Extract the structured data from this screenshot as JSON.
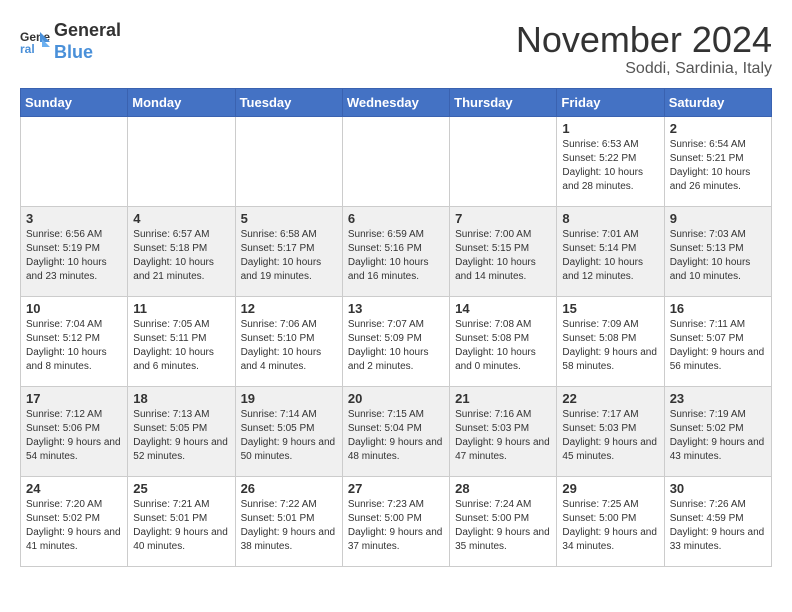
{
  "logo": {
    "line1": "General",
    "line2": "Blue"
  },
  "title": "November 2024",
  "location": "Soddi, Sardinia, Italy",
  "weekdays": [
    "Sunday",
    "Monday",
    "Tuesday",
    "Wednesday",
    "Thursday",
    "Friday",
    "Saturday"
  ],
  "weeks": [
    [
      {
        "day": "",
        "info": ""
      },
      {
        "day": "",
        "info": ""
      },
      {
        "day": "",
        "info": ""
      },
      {
        "day": "",
        "info": ""
      },
      {
        "day": "",
        "info": ""
      },
      {
        "day": "1",
        "info": "Sunrise: 6:53 AM\nSunset: 5:22 PM\nDaylight: 10 hours and 28 minutes."
      },
      {
        "day": "2",
        "info": "Sunrise: 6:54 AM\nSunset: 5:21 PM\nDaylight: 10 hours and 26 minutes."
      }
    ],
    [
      {
        "day": "3",
        "info": "Sunrise: 6:56 AM\nSunset: 5:19 PM\nDaylight: 10 hours and 23 minutes."
      },
      {
        "day": "4",
        "info": "Sunrise: 6:57 AM\nSunset: 5:18 PM\nDaylight: 10 hours and 21 minutes."
      },
      {
        "day": "5",
        "info": "Sunrise: 6:58 AM\nSunset: 5:17 PM\nDaylight: 10 hours and 19 minutes."
      },
      {
        "day": "6",
        "info": "Sunrise: 6:59 AM\nSunset: 5:16 PM\nDaylight: 10 hours and 16 minutes."
      },
      {
        "day": "7",
        "info": "Sunrise: 7:00 AM\nSunset: 5:15 PM\nDaylight: 10 hours and 14 minutes."
      },
      {
        "day": "8",
        "info": "Sunrise: 7:01 AM\nSunset: 5:14 PM\nDaylight: 10 hours and 12 minutes."
      },
      {
        "day": "9",
        "info": "Sunrise: 7:03 AM\nSunset: 5:13 PM\nDaylight: 10 hours and 10 minutes."
      }
    ],
    [
      {
        "day": "10",
        "info": "Sunrise: 7:04 AM\nSunset: 5:12 PM\nDaylight: 10 hours and 8 minutes."
      },
      {
        "day": "11",
        "info": "Sunrise: 7:05 AM\nSunset: 5:11 PM\nDaylight: 10 hours and 6 minutes."
      },
      {
        "day": "12",
        "info": "Sunrise: 7:06 AM\nSunset: 5:10 PM\nDaylight: 10 hours and 4 minutes."
      },
      {
        "day": "13",
        "info": "Sunrise: 7:07 AM\nSunset: 5:09 PM\nDaylight: 10 hours and 2 minutes."
      },
      {
        "day": "14",
        "info": "Sunrise: 7:08 AM\nSunset: 5:08 PM\nDaylight: 10 hours and 0 minutes."
      },
      {
        "day": "15",
        "info": "Sunrise: 7:09 AM\nSunset: 5:08 PM\nDaylight: 9 hours and 58 minutes."
      },
      {
        "day": "16",
        "info": "Sunrise: 7:11 AM\nSunset: 5:07 PM\nDaylight: 9 hours and 56 minutes."
      }
    ],
    [
      {
        "day": "17",
        "info": "Sunrise: 7:12 AM\nSunset: 5:06 PM\nDaylight: 9 hours and 54 minutes."
      },
      {
        "day": "18",
        "info": "Sunrise: 7:13 AM\nSunset: 5:05 PM\nDaylight: 9 hours and 52 minutes."
      },
      {
        "day": "19",
        "info": "Sunrise: 7:14 AM\nSunset: 5:05 PM\nDaylight: 9 hours and 50 minutes."
      },
      {
        "day": "20",
        "info": "Sunrise: 7:15 AM\nSunset: 5:04 PM\nDaylight: 9 hours and 48 minutes."
      },
      {
        "day": "21",
        "info": "Sunrise: 7:16 AM\nSunset: 5:03 PM\nDaylight: 9 hours and 47 minutes."
      },
      {
        "day": "22",
        "info": "Sunrise: 7:17 AM\nSunset: 5:03 PM\nDaylight: 9 hours and 45 minutes."
      },
      {
        "day": "23",
        "info": "Sunrise: 7:19 AM\nSunset: 5:02 PM\nDaylight: 9 hours and 43 minutes."
      }
    ],
    [
      {
        "day": "24",
        "info": "Sunrise: 7:20 AM\nSunset: 5:02 PM\nDaylight: 9 hours and 41 minutes."
      },
      {
        "day": "25",
        "info": "Sunrise: 7:21 AM\nSunset: 5:01 PM\nDaylight: 9 hours and 40 minutes."
      },
      {
        "day": "26",
        "info": "Sunrise: 7:22 AM\nSunset: 5:01 PM\nDaylight: 9 hours and 38 minutes."
      },
      {
        "day": "27",
        "info": "Sunrise: 7:23 AM\nSunset: 5:00 PM\nDaylight: 9 hours and 37 minutes."
      },
      {
        "day": "28",
        "info": "Sunrise: 7:24 AM\nSunset: 5:00 PM\nDaylight: 9 hours and 35 minutes."
      },
      {
        "day": "29",
        "info": "Sunrise: 7:25 AM\nSunset: 5:00 PM\nDaylight: 9 hours and 34 minutes."
      },
      {
        "day": "30",
        "info": "Sunrise: 7:26 AM\nSunset: 4:59 PM\nDaylight: 9 hours and 33 minutes."
      }
    ]
  ]
}
